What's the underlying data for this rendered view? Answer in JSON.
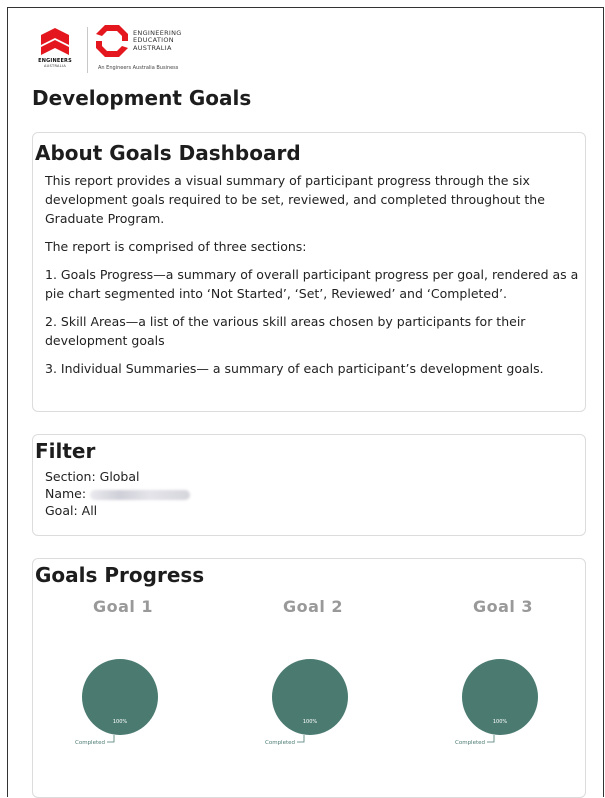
{
  "brand": {
    "ea_name": "ENGINEERS",
    "ea_sub": "AUSTRALIA",
    "ee_line1": "ENGINEERING",
    "ee_line2": "EDUCATION",
    "ee_line3": "AUSTRALIA",
    "ee_tagline": "An Engineers Australia Business"
  },
  "page_title": "Development Goals",
  "about": {
    "heading": "About Goals Dashboard",
    "p1": "This report provides a visual summary of participant progress through the six development goals required to be set, reviewed, and completed throughout the Graduate Program.",
    "p2": "The report is comprised of three sections:",
    "p3": "1. Goals Progress—a summary of overall participant progress per goal, rendered as a pie chart segmented into ‘Not Started’, ‘Set’, Reviewed’ and ‘Completed’.",
    "p4": "2. Skill Areas—a list of the various skill areas chosen by participants for their development goals",
    "p5": "3. Individual Summaries— a summary of each participant’s development goals."
  },
  "filter": {
    "heading": "Filter",
    "section_label": "Section: Global",
    "name_label": "Name:",
    "goal_label": "Goal: All"
  },
  "progress": {
    "heading": "Goals Progress"
  },
  "colors": {
    "pie_completed": "#4a7a70",
    "brand_red": "#e3171d"
  },
  "chart_data": [
    {
      "type": "pie",
      "title": "Goal 1",
      "categories": [
        "Completed"
      ],
      "values": [
        100
      ],
      "labels": [
        "100%"
      ]
    },
    {
      "type": "pie",
      "title": "Goal 2",
      "categories": [
        "Completed"
      ],
      "values": [
        100
      ],
      "labels": [
        "100%"
      ]
    },
    {
      "type": "pie",
      "title": "Goal 3",
      "categories": [
        "Completed"
      ],
      "values": [
        100
      ],
      "labels": [
        "100%"
      ]
    }
  ]
}
